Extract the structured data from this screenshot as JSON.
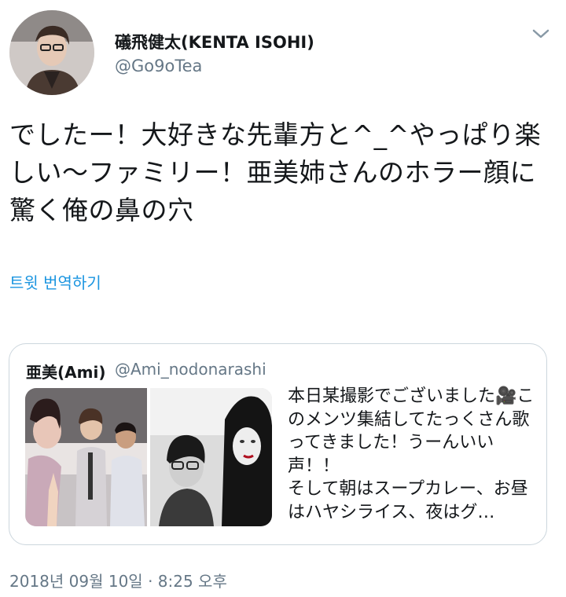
{
  "author": {
    "display_name": "礒飛健太(KENTA ISOHI)",
    "handle": "@Go9oTea"
  },
  "tweet": {
    "text": "でしたー！大好きな先輩方と^_^やっぱり楽しい〜ファミリー！亜美姉さんのホラー顔に驚く俺の鼻の穴",
    "translate_label": "트윗 번역하기",
    "timestamp": "2018년 09월 10일 · 8:25 오후"
  },
  "quoted": {
    "display_name": "亜美(Ami)",
    "handle": "@Ami_nodonarashi",
    "text": "本日某撮影でございました🎥このメンツ集結してたっくさん歌ってきました！うーんいい声！！\nそして朝はスープカレー、お昼はハヤシライス、夜はグ…"
  },
  "icons": {
    "menu": "chevron-down-icon",
    "avatar": "profile-photo",
    "media": "photo-thumbnails"
  },
  "colors": {
    "link": "#1b95e0",
    "secondary_text": "#657786",
    "border": "#ccd6dd"
  }
}
